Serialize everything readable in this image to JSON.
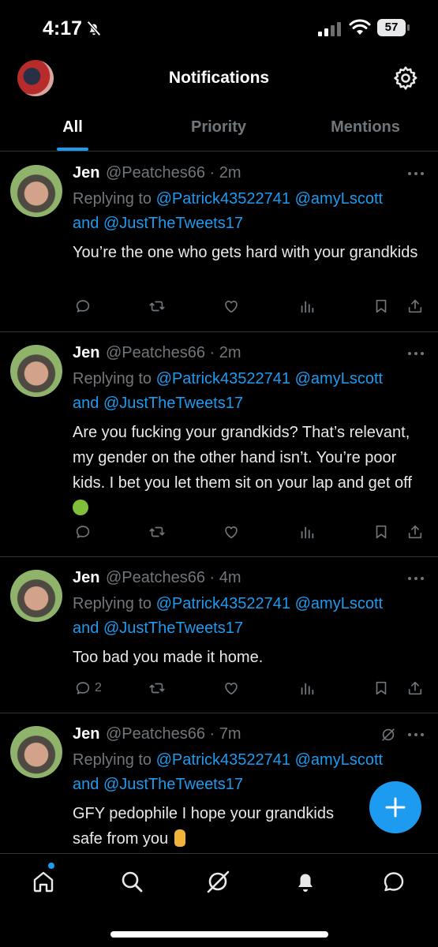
{
  "status_bar": {
    "time": "4:17",
    "battery": "57"
  },
  "header": {
    "title": "Notifications"
  },
  "tabs": [
    {
      "label": "All",
      "active": true
    },
    {
      "label": "Priority",
      "active": false
    },
    {
      "label": "Mentions",
      "active": false
    }
  ],
  "tweets": [
    {
      "name": "Jen",
      "handle": "@Peatches66 · 2m",
      "replying_prefix": "Replying to ",
      "reply_user1": "@Patrick43522741",
      "reply_user2": "@amyLscott",
      "reply_and": "and ",
      "reply_user3": "@JustTheTweets17",
      "text": "You’re the one who gets hard with your grandkids",
      "reply_count": ""
    },
    {
      "name": "Jen",
      "handle": "@Peatches66 · 2m",
      "replying_prefix": "Replying to ",
      "reply_user1": "@Patrick43522741",
      "reply_user2": "@amyLscott",
      "reply_and": "and ",
      "reply_user3": "@JustTheTweets17",
      "text": "Are you fucking your grandkids? That’s relevant, my gender on the other hand isn’t. You’re poor kids. I bet you let them sit on your lap and get off",
      "emoji": "nauseated-face-emoji",
      "reply_count": ""
    },
    {
      "name": "Jen",
      "handle": "@Peatches66 · 4m",
      "replying_prefix": "Replying to ",
      "reply_user1": "@Patrick43522741",
      "reply_user2": "@amyLscott",
      "reply_and": "and ",
      "reply_user3": "@JustTheTweets17",
      "text": "Too bad you made it home.",
      "reply_count": "2"
    },
    {
      "name": "Jen",
      "handle": "@Peatches66 · 7m",
      "replying_prefix": "Replying to ",
      "reply_user1": "@Patrick43522741",
      "reply_user2": "@amyLscott",
      "reply_and": "and ",
      "reply_user3": "@JustTheTweets17",
      "text": "GFY pedophile I hope your grandkids",
      "text_line2": "safe from you",
      "emoji": "middle-finger-emoji",
      "muted_icon": true,
      "reply_count": ""
    }
  ],
  "colors": {
    "accent": "#1d9bf0",
    "background": "#000000",
    "muted_text": "#71767b",
    "divider": "#2f3336"
  },
  "icons": {
    "bottom_nav": [
      "home-icon",
      "search-icon",
      "grok-icon",
      "notifications-bell-icon",
      "messages-icon"
    ],
    "actions": [
      "reply-icon",
      "retweet-icon",
      "like-icon",
      "views-icon",
      "bookmark-icon",
      "share-icon"
    ]
  }
}
